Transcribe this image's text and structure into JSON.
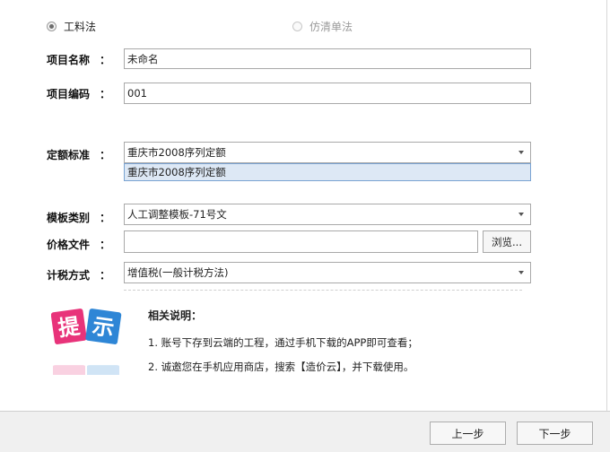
{
  "radios": [
    {
      "label": "工料法",
      "checked": true,
      "enabled": true
    },
    {
      "label": "仿清单法",
      "checked": false,
      "enabled": false
    }
  ],
  "fields": {
    "project_name": {
      "label": "项目名称",
      "colon": "：",
      "value": "未命名"
    },
    "project_code": {
      "label": "项目编码",
      "colon": "：",
      "value": "001"
    },
    "quota_standard": {
      "label": "定额标准",
      "colon": "：",
      "value": "重庆市2008序列定额",
      "dropdown_option": "重庆市2008序列定额"
    },
    "template_type": {
      "label": "模板类别",
      "colon": "：",
      "value": "人工调整模板-71号文"
    },
    "price_file": {
      "label": "价格文件",
      "colon": "：",
      "value": "",
      "browse_label": "浏览..."
    },
    "tax_method": {
      "label": "计税方式",
      "colon": "：",
      "value": "增值税(一般计税方法)"
    }
  },
  "tip": {
    "icon_text": "提示",
    "icon_colors": {
      "left": "#e8337a",
      "right": "#2e86d6"
    },
    "title": "相关说明：",
    "lines": [
      "1.  账号下存到云端的工程，通过手机下载的APP即可查看；",
      "2.  诚邀您在手机应用商店，搜索【造价云】，并下载使用。"
    ]
  },
  "footer": {
    "prev_label": "上一步",
    "next_label": "下一步"
  }
}
